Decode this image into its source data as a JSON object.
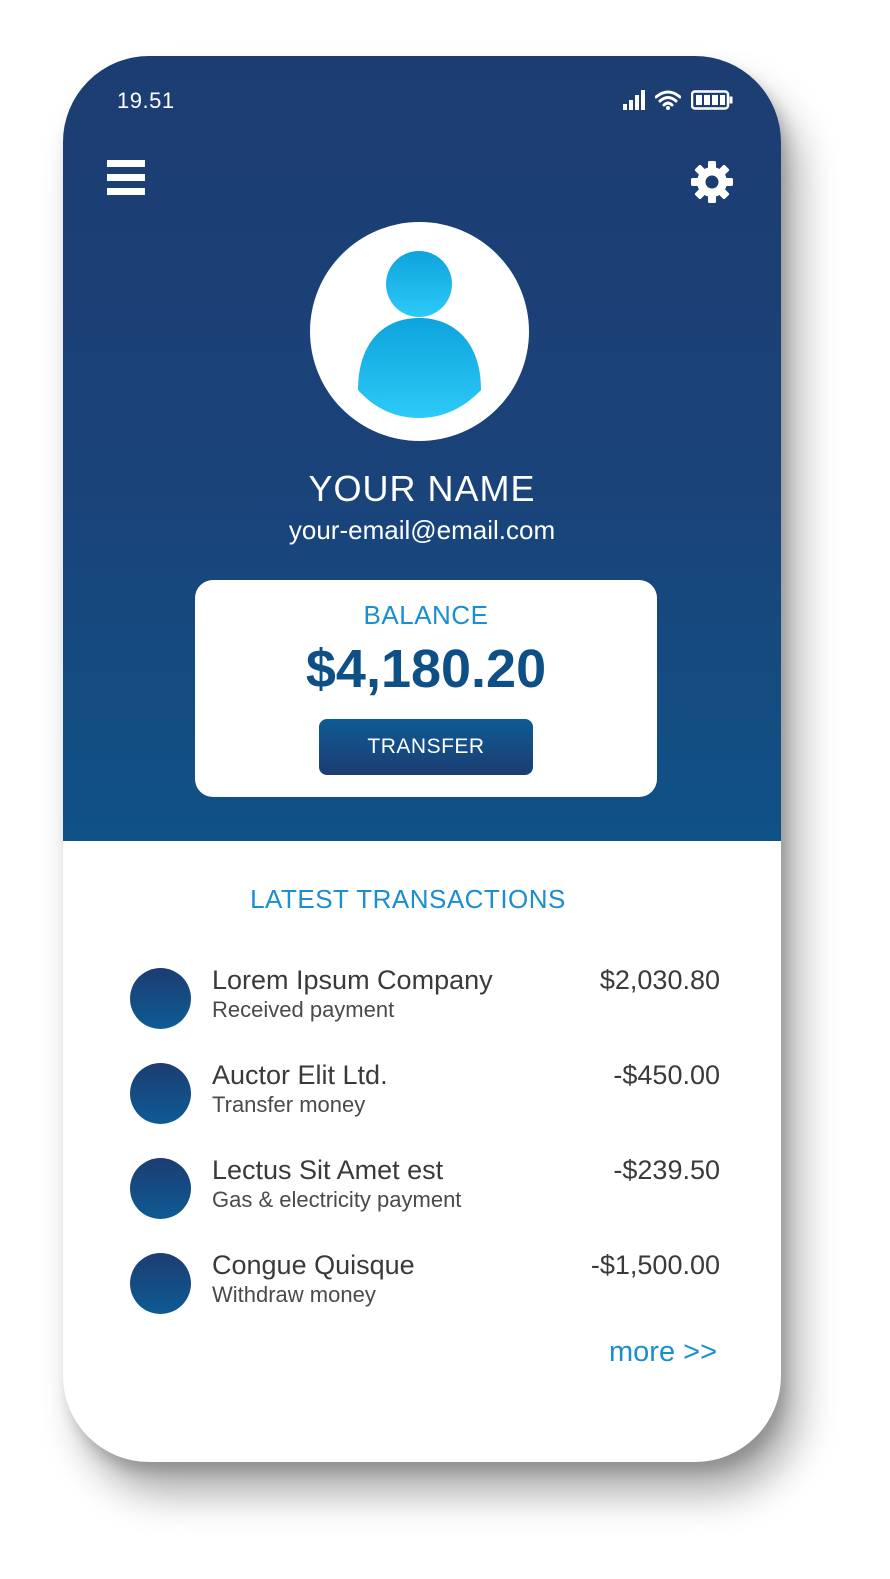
{
  "status_bar": {
    "time": "19.51",
    "icons": [
      "signal-icon",
      "wifi-icon",
      "battery-icon"
    ]
  },
  "header": {
    "menu_icon": "hamburger-menu-icon",
    "settings_icon": "gear-icon"
  },
  "profile": {
    "avatar_icon": "user-avatar-icon",
    "name": "YOUR NAME",
    "email": "your-email@email.com"
  },
  "balance": {
    "label": "BALANCE",
    "amount": "$4,180.20",
    "transfer_label": "TRANSFER"
  },
  "transactions": {
    "title": "LATEST TRANSACTIONS",
    "items": [
      {
        "name": "Lorem Ipsum Company",
        "description": "Received payment",
        "amount": "$2,030.80"
      },
      {
        "name": "Auctor Elit Ltd.",
        "description": "Transfer money",
        "amount": "-$450.00"
      },
      {
        "name": "Lectus Sit Amet est",
        "description": "Gas & electricity payment",
        "amount": "-$239.50"
      },
      {
        "name": "Congue Quisque",
        "description": "Withdraw money",
        "amount": "-$1,500.00"
      }
    ],
    "more_label": "more >>"
  },
  "colors": {
    "primary_dark": "#1c3d72",
    "primary": "#0e5b94",
    "accent": "#1a8fd0",
    "avatar_light": "#29c4f5"
  }
}
